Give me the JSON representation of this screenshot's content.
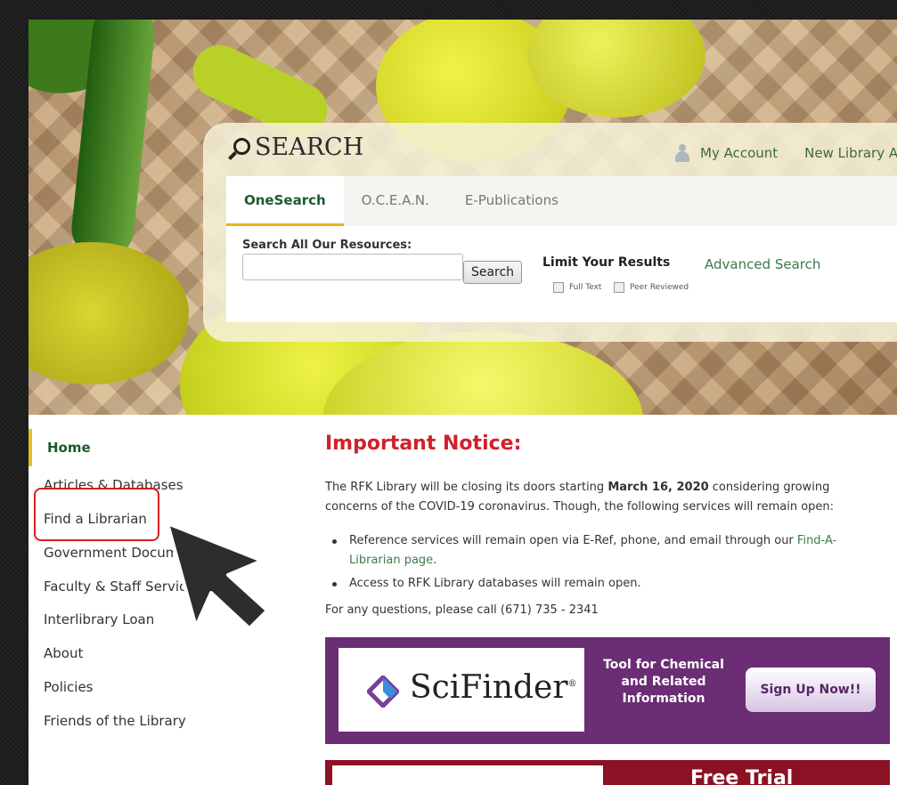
{
  "search": {
    "title": "SEARCH",
    "account_links": [
      "My Account",
      "New Library A"
    ],
    "tabs": [
      "OneSearch",
      "O.C.E.A.N.",
      "E-Publications"
    ],
    "active_tab": "OneSearch",
    "label": "Search All Our Resources:",
    "input_value": "",
    "button": "Search",
    "limit_label": "Limit Your Results",
    "advanced": "Advanced Search",
    "filters": [
      "Full Text",
      "Peer Reviewed"
    ]
  },
  "nav": {
    "items": [
      "Home",
      "Articles & Databases",
      "Find a Librarian",
      "Government Docum",
      "Faculty & Staff Servic",
      "Interlibrary Loan",
      "About",
      "Policies",
      "Friends of the Library"
    ],
    "active": "Home",
    "highlighted": "Find a Librarian"
  },
  "notice": {
    "title": "Important Notice:",
    "para_before": "The RFK Library will be closing its doors starting ",
    "para_bold": "March 16, 2020",
    "para_after": " considering growing concerns of the COVID-19 coronavirus. Though, the following services will remain open:",
    "bullet1_text": "Reference services will remain open via E-Ref, phone, and email through our ",
    "bullet1_link": "Find-A-Librarian page",
    "bullet1_end": ".",
    "bullet2": "Access to RFK Library databases will remain open.",
    "contact": "For any questions, please call (671) 735 - 2341"
  },
  "banner": {
    "brand": "SciFinder",
    "reg": "®",
    "tool_text": "Tool for Chemical and Related Information",
    "cta": "Sign Up Now!!"
  },
  "banner2": {
    "title": "Free Trial"
  },
  "colors": {
    "accent_green": "#1c5a2e",
    "accent_yellow": "#e2c127",
    "notice_red": "#d2202a",
    "banner_purple": "#6b2d74",
    "highlight_red": "#d82020"
  }
}
